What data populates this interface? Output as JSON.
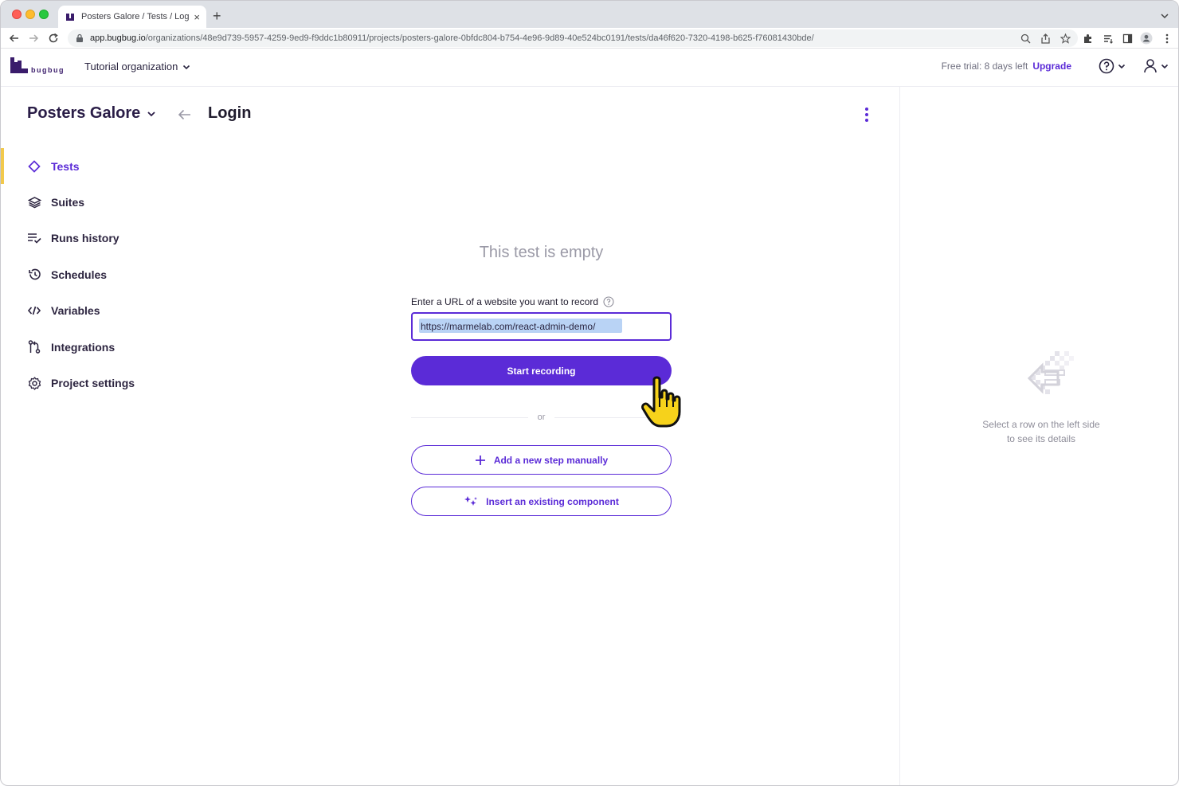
{
  "browser": {
    "tab_title": "Posters Galore / Tests / Login · ",
    "tab_close": "×",
    "new_tab": "+",
    "url_domain": "app.bugbug.io",
    "url_path": "/organizations/48e9d739-5957-4259-9ed9-f9ddc1b80911/projects/posters-galore-0bfdc804-b754-4e96-9d89-40e524bc0191/tests/da46f620-7320-4198-b625-f76081430bde/"
  },
  "header": {
    "logo_text": "bugbug",
    "organization": "Tutorial organization",
    "trial_text": "Free trial: 8 days left",
    "upgrade_label": "Upgrade"
  },
  "project": {
    "name": "Posters Galore"
  },
  "sidebar": {
    "items": [
      {
        "label": "Tests",
        "icon": "diamond-icon",
        "active": true
      },
      {
        "label": "Suites",
        "icon": "layers-icon"
      },
      {
        "label": "Runs history",
        "icon": "list-check-icon"
      },
      {
        "label": "Schedules",
        "icon": "history-clock-icon"
      },
      {
        "label": "Variables",
        "icon": "code-icon"
      },
      {
        "label": "Integrations",
        "icon": "git-branch-icon"
      },
      {
        "label": "Project settings",
        "icon": "gear-icon"
      }
    ]
  },
  "page": {
    "title": "Login"
  },
  "empty_state": {
    "title": "This test is empty",
    "url_label": "Enter a URL of a website you want to record",
    "url_value": "https://marmelab.com/react-admin-demo/",
    "record_button": "Start recording",
    "or_text": "or",
    "add_step_button": "Add a new step manually",
    "insert_component_button": "Insert an existing component"
  },
  "details_panel": {
    "hint_line1": "Select a row on the left side",
    "hint_line2": "to see its details"
  },
  "colors": {
    "accent": "#5b2bd7",
    "active_indicator": "#f2c94c",
    "muted_text": "#9a99a6"
  }
}
